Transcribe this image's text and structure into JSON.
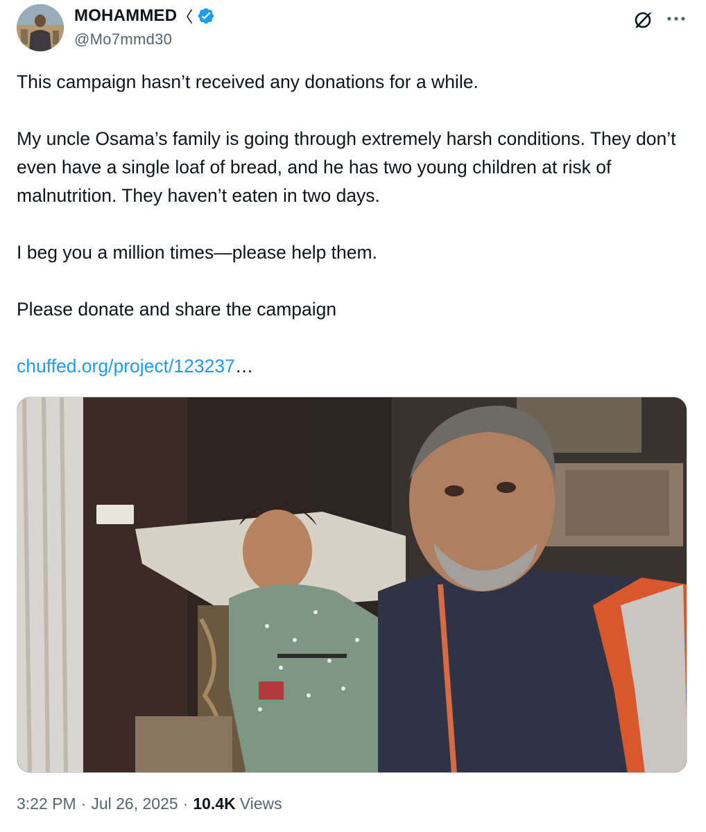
{
  "author": {
    "display_name": "MOHAMMED",
    "name_suffix_glyph": "〈",
    "handle": "@Mo7mmd30",
    "verified": true,
    "verified_color": "#1d9bf0"
  },
  "header_icons": {
    "grok": "grok-icon",
    "more": "more-options-icon"
  },
  "tweet": {
    "paragraphs": [
      "This campaign hasn’t received any donations for a while.",
      "My uncle Osama’s family is going through extremely harsh conditions. They don’t even have a single loaf of bread, and he has two young children at risk of malnutrition. They haven’t eaten in two days.",
      "I beg you a million times—please help them.",
      "Please donate and share the campaign"
    ],
    "link_text": "chuffed.org/project/123237",
    "link_ellipsis": "…",
    "link_color": "#1d9bf0"
  },
  "footer": {
    "time": "3:22 PM",
    "separator": "·",
    "date": "Jul 26, 2025",
    "views_count": "10.4K",
    "views_label": "Views"
  }
}
